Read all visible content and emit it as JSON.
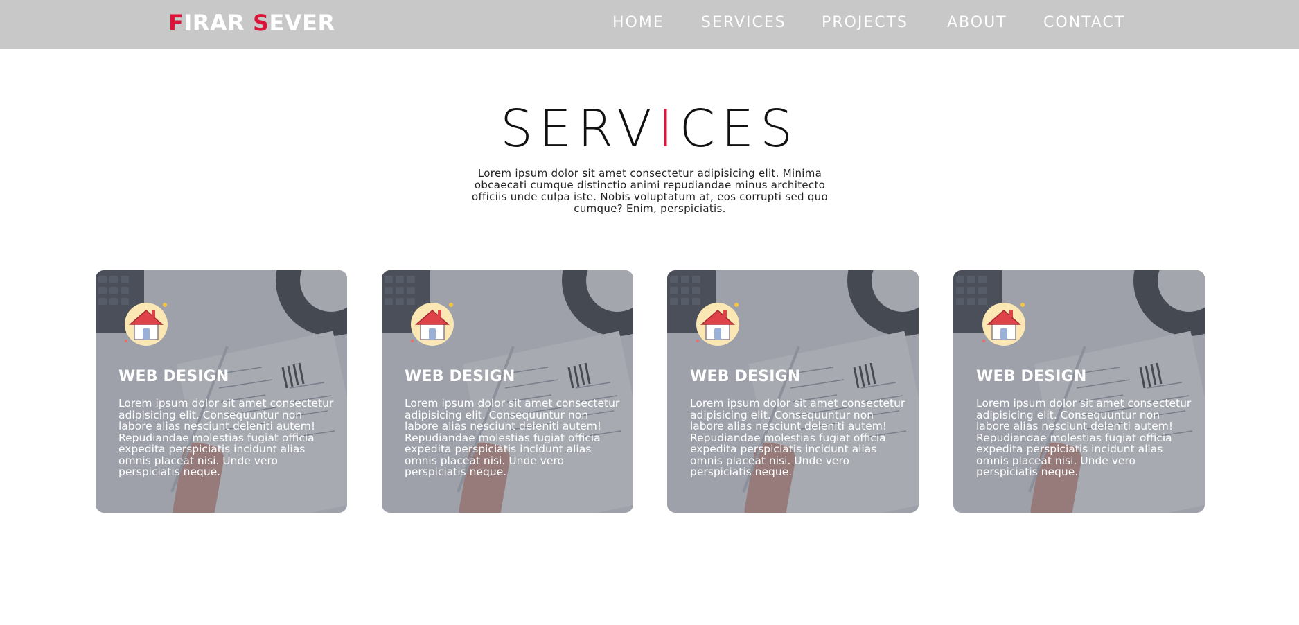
{
  "header": {
    "logo": {
      "letter1": "F",
      "rest1": "IRAR ",
      "letter2": "S",
      "rest2": "EVER"
    },
    "nav": [
      {
        "label": "HOME"
      },
      {
        "label": "SERVICES"
      },
      {
        "label": "PROJECTS"
      },
      {
        "label": "ABOUT"
      },
      {
        "label": "CONTACT"
      }
    ]
  },
  "section": {
    "title_part1": "SERV",
    "title_accent": "I",
    "title_part2": "CES",
    "intro": "Lorem ipsum dolor sit amet consectetur adipisicing elit. Minima obcaecati cumque distinctio animi repudiandae minus architecto officiis unde culpa iste. Nobis voluptatum at, eos corrupti sed quo cumque? Enim, perspiciatis."
  },
  "cards": [
    {
      "title": "WEB DESIGN",
      "text": "Lorem ipsum dolor sit amet consectetur adipisicing elit. Consequuntur non labore alias nesciunt deleniti autem! Repudiandae molestias fugiat officia expedita perspiciatis incidunt alias omnis placeat nisi. Unde vero perspiciatis neque.",
      "icon": "house-icon"
    },
    {
      "title": "WEB DESIGN",
      "text": "Lorem ipsum dolor sit amet consectetur adipisicing elit. Consequuntur non labore alias nesciunt deleniti autem! Repudiandae molestias fugiat officia expedita perspiciatis incidunt alias omnis placeat nisi. Unde vero perspiciatis neque.",
      "icon": "house-icon"
    },
    {
      "title": "WEB DESIGN",
      "text": "Lorem ipsum dolor sit amet consectetur adipisicing elit. Consequuntur non labore alias nesciunt deleniti autem! Repudiandae molestias fugiat officia expedita perspiciatis incidunt alias omnis placeat nisi. Unde vero perspiciatis neque.",
      "icon": "house-icon"
    },
    {
      "title": "WEB DESIGN",
      "text": "Lorem ipsum dolor sit amet consectetur adipisicing elit. Consequuntur non labore alias nesciunt deleniti autem! Repudiandae molestias fugiat officia expedita perspiciatis incidunt alias omnis placeat nisi. Unde vero perspiciatis neque.",
      "icon": "house-icon"
    }
  ],
  "colors": {
    "accent": "#dc143c",
    "header_bg": "#c8c8c8",
    "nav_text": "#ffffff"
  }
}
